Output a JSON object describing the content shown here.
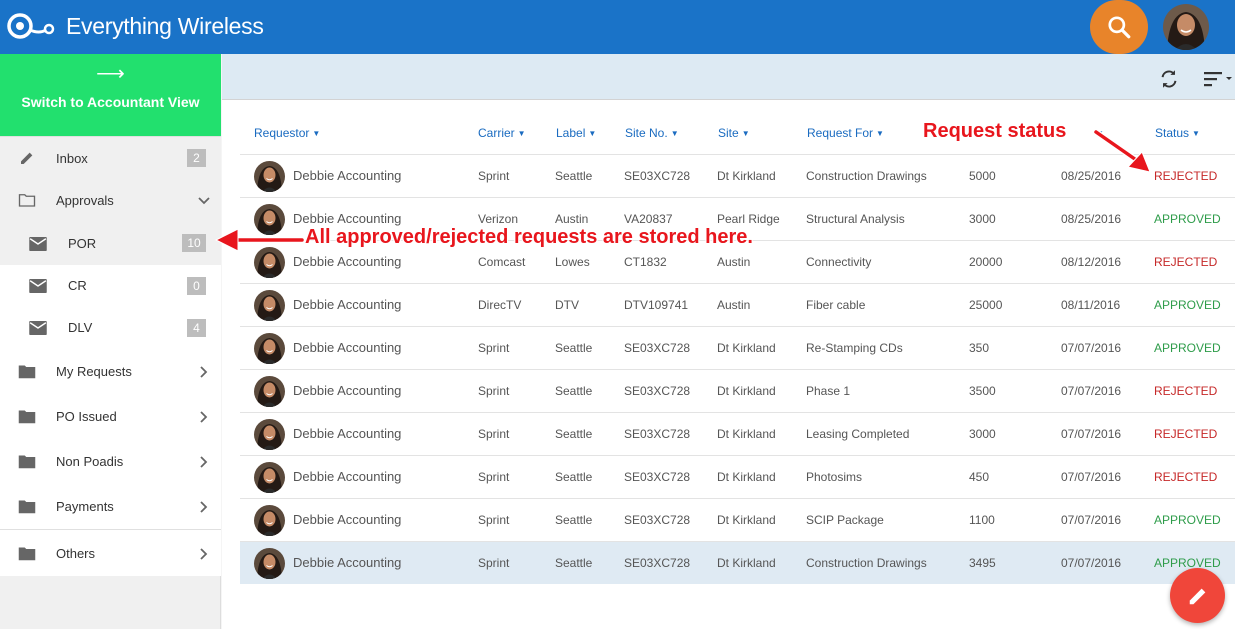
{
  "app": {
    "title": "Everything Wireless"
  },
  "sidebar": {
    "switch_label": "Switch to Accountant View",
    "items": [
      {
        "label": "Inbox",
        "badge": "2"
      },
      {
        "label": "Approvals"
      },
      {
        "label": "POR",
        "badge": "10"
      },
      {
        "label": "CR",
        "badge": "0"
      },
      {
        "label": "DLV",
        "badge": "4"
      },
      {
        "label": "My Requests"
      },
      {
        "label": "PO Issued"
      },
      {
        "label": "Non Poadis"
      },
      {
        "label": "Payments"
      },
      {
        "label": "Others"
      }
    ]
  },
  "table": {
    "headers": {
      "requestor": "Requestor",
      "carrier": "Carrier",
      "label": "Label",
      "site_no": "Site No.",
      "site": "Site",
      "request_for": "Request For",
      "status": "Status"
    },
    "rows": [
      {
        "requestor": "Debbie Accounting",
        "carrier": "Sprint",
        "label": "Seattle",
        "site_no": "SE03XC728",
        "site": "Dt Kirkland",
        "request_for": "Construction Drawings",
        "amount": "5000",
        "date": "08/25/2016",
        "status": "REJECTED"
      },
      {
        "requestor": "Debbie Accounting",
        "carrier": "Verizon",
        "label": "Austin",
        "site_no": "VA20837",
        "site": "Pearl Ridge",
        "request_for": "Structural Analysis",
        "amount": "3000",
        "date": "08/25/2016",
        "status": "APPROVED"
      },
      {
        "requestor": "Debbie Accounting",
        "carrier": "Comcast",
        "label": "Lowes",
        "site_no": "CT1832",
        "site": "Austin",
        "request_for": "Connectivity",
        "amount": "20000",
        "date": "08/12/2016",
        "status": "REJECTED"
      },
      {
        "requestor": "Debbie Accounting",
        "carrier": "DirecTV",
        "label": "DTV",
        "site_no": "DTV109741",
        "site": "Austin",
        "request_for": "Fiber cable",
        "amount": "25000",
        "date": "08/11/2016",
        "status": "APPROVED"
      },
      {
        "requestor": "Debbie Accounting",
        "carrier": "Sprint",
        "label": "Seattle",
        "site_no": "SE03XC728",
        "site": "Dt Kirkland",
        "request_for": "Re-Stamping CDs",
        "amount": "350",
        "date": "07/07/2016",
        "status": "APPROVED"
      },
      {
        "requestor": "Debbie Accounting",
        "carrier": "Sprint",
        "label": "Seattle",
        "site_no": "SE03XC728",
        "site": "Dt Kirkland",
        "request_for": "Phase 1",
        "amount": "3500",
        "date": "07/07/2016",
        "status": "REJECTED"
      },
      {
        "requestor": "Debbie Accounting",
        "carrier": "Sprint",
        "label": "Seattle",
        "site_no": "SE03XC728",
        "site": "Dt Kirkland",
        "request_for": "Leasing Completed",
        "amount": "3000",
        "date": "07/07/2016",
        "status": "REJECTED"
      },
      {
        "requestor": "Debbie Accounting",
        "carrier": "Sprint",
        "label": "Seattle",
        "site_no": "SE03XC728",
        "site": "Dt Kirkland",
        "request_for": "Photosims",
        "amount": "450",
        "date": "07/07/2016",
        "status": "REJECTED"
      },
      {
        "requestor": "Debbie Accounting",
        "carrier": "Sprint",
        "label": "Seattle",
        "site_no": "SE03XC728",
        "site": "Dt Kirkland",
        "request_for": "SCIP Package",
        "amount": "1100",
        "date": "07/07/2016",
        "status": "APPROVED"
      },
      {
        "requestor": "Debbie Accounting",
        "carrier": "Sprint",
        "label": "Seattle",
        "site_no": "SE03XC728",
        "site": "Dt Kirkland",
        "request_for": "Construction Drawings",
        "amount": "3495",
        "date": "07/07/2016",
        "status": "APPROVED"
      }
    ]
  },
  "annotations": {
    "status": "Request status",
    "stored": "All approved/rejected requests are stored here."
  },
  "colors": {
    "topbar": "#1a73c8",
    "switch_view": "#22e06e",
    "search": "#e8842a",
    "fab": "#f0463a",
    "rejected": "#c62828",
    "approved": "#2e9c4a",
    "annotation": "#e8161d"
  },
  "icons": {
    "logo": "logo-icon",
    "search": "search-icon",
    "switch": "arrow-right-icon",
    "inbox": "pencil-icon",
    "approvals": "folder-outline-icon",
    "mail": "mail-icon",
    "folder": "folder-icon",
    "refresh": "refresh-icon",
    "sort": "sort-icon",
    "fab": "pencil-icon"
  }
}
